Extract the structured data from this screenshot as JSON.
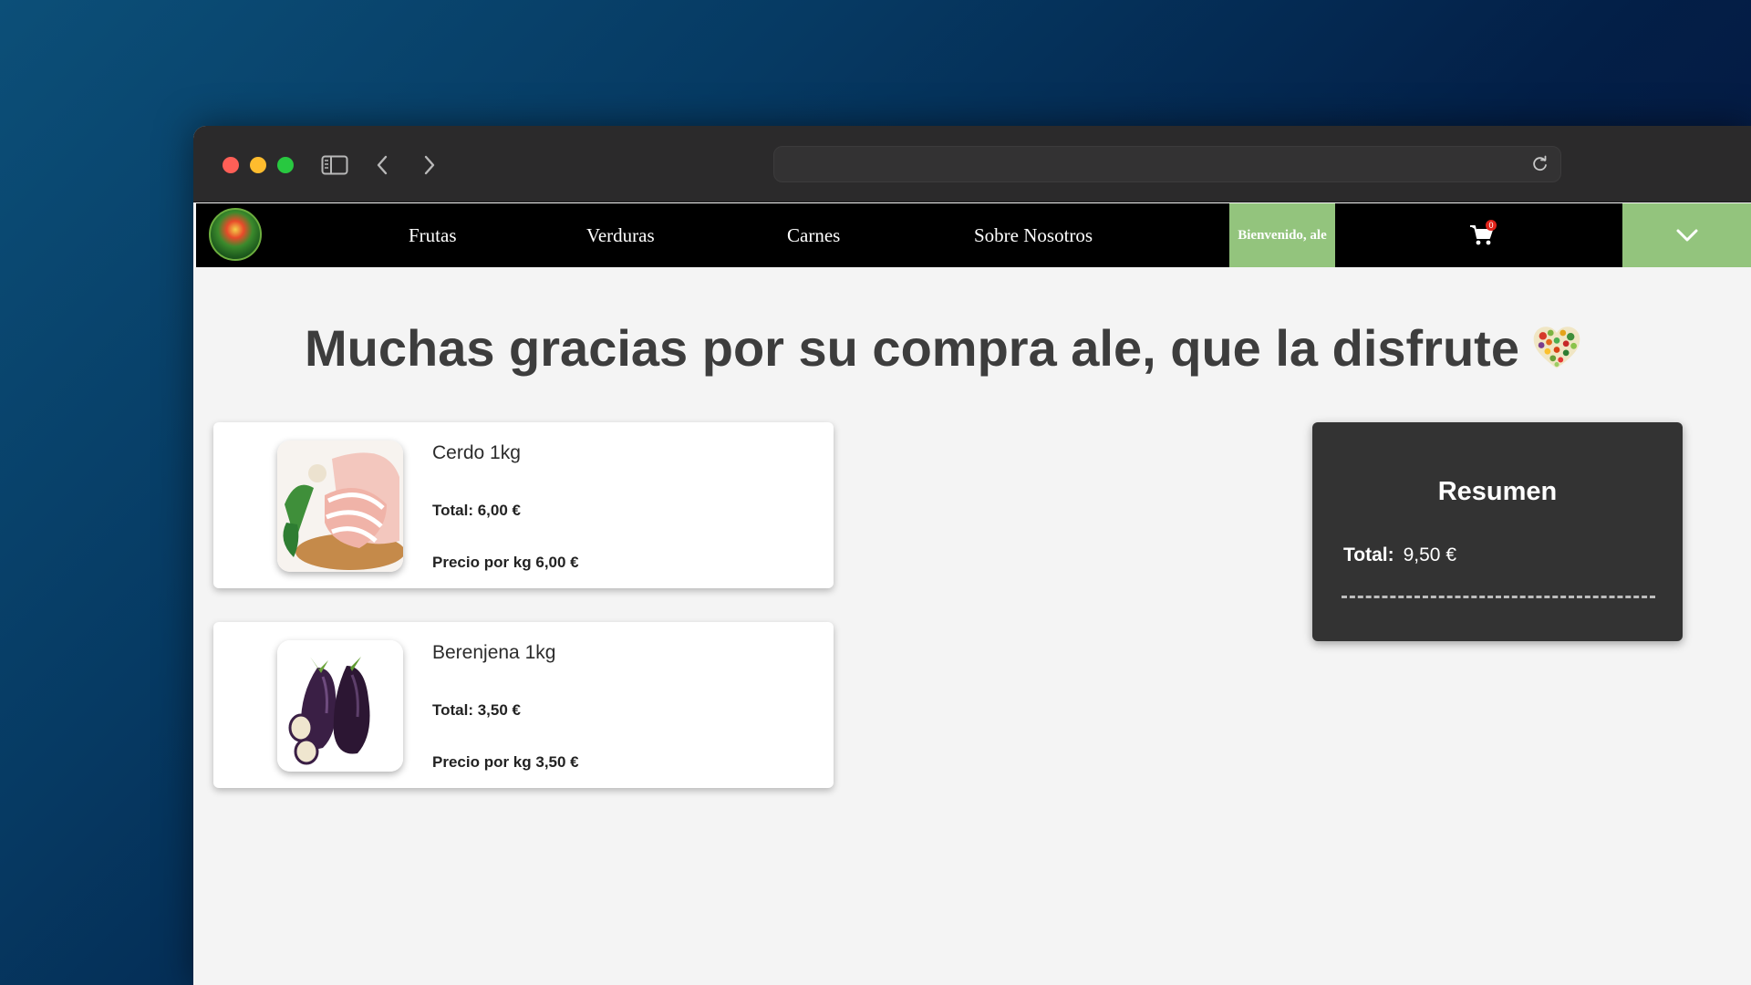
{
  "browser": {
    "url": ""
  },
  "nav": {
    "links": [
      "Frutas",
      "Verduras",
      "Carnes",
      "Sobre Nosotros"
    ],
    "welcome": "Bienvenido, ale",
    "cart_count": "0"
  },
  "main": {
    "heading": "Muchas gracias por su compra ale, que la disfrute",
    "products": [
      {
        "name": "Cerdo 1kg",
        "total": "Total: 6,00 €",
        "price_per_kg": "Precio por kg 6,00 €",
        "image": "pork-meat-image"
      },
      {
        "name": "Berenjena 1kg",
        "total": "Total: 3,50 €",
        "price_per_kg": "Precio por kg 3,50 €",
        "image": "eggplant-image"
      }
    ]
  },
  "summary": {
    "title": "Resumen",
    "total_label": "Total:",
    "total_value": "9,50 €"
  },
  "colors": {
    "nav_bg": "#000000",
    "accent_green": "#93c47d",
    "summary_bg": "#333333",
    "page_bg": "#f4f4f4"
  }
}
